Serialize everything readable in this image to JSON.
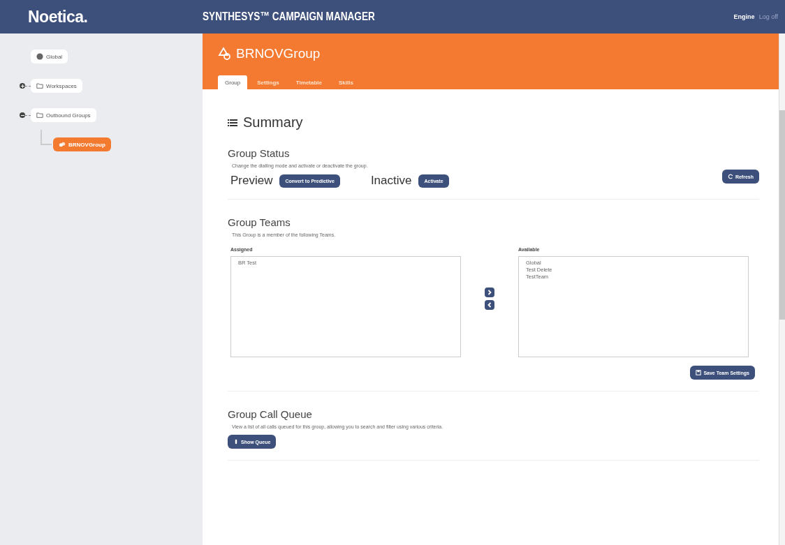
{
  "header": {
    "logo": "Noetica.",
    "title": "SYNTHESYS™ CAMPAIGN MANAGER",
    "user": "Engine",
    "logout": "Log off"
  },
  "tree": [
    {
      "label": "Global",
      "kind": "globe",
      "selected": false
    },
    {
      "label": "Workspaces",
      "kind": "folder",
      "selected": false,
      "expanded": false
    },
    {
      "label": "Outbound Groups",
      "kind": "folder",
      "selected": false,
      "expanded": true,
      "children": [
        {
          "label": "BRNOVGroup",
          "kind": "group",
          "selected": true
        }
      ]
    }
  ],
  "page": {
    "title": "BRNOVGroup",
    "tabs": [
      {
        "label": "Group",
        "selected": true
      },
      {
        "label": "Settings",
        "selected": false
      },
      {
        "label": "Timetable",
        "selected": false
      },
      {
        "label": "Skills",
        "selected": false
      }
    ]
  },
  "summary": {
    "heading": "Summary",
    "status": {
      "heading": "Group Status",
      "description": "Change the dialling mode and activate or deactivate the group.",
      "mode": "Preview",
      "mode_button": "Convert to Predictive",
      "state": "Inactive",
      "state_button": "Activate",
      "refresh": "Refresh"
    },
    "teams": {
      "heading": "Group Teams",
      "description": "This Group is a member of the following Teams.",
      "assigned_label": "Assigned",
      "assigned": [
        "BR Test"
      ],
      "available_label": "Available",
      "available": [
        "Global",
        "Test Delete",
        "TestTeam"
      ],
      "save": "Save Team Settings"
    },
    "queue": {
      "heading": "Group Call Queue",
      "description": "View a list of all calls queued for this group, allowing you to search and filter using various criteria.",
      "button": "Show Queue"
    }
  }
}
